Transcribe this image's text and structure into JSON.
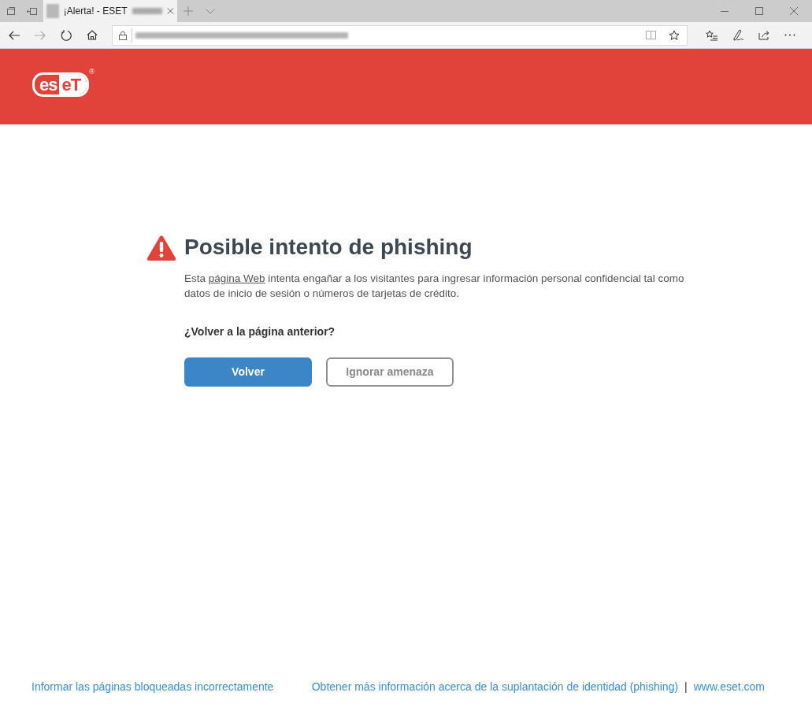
{
  "browser": {
    "tab": {
      "title": "¡Alerta! - ESET",
      "selected": true
    }
  },
  "header": {
    "logo_left": "es",
    "logo_right": "eT",
    "logo_mark": "®"
  },
  "warning": {
    "title": "Posible intento de phishing",
    "description": {
      "before": "Esta ",
      "link": "página Web",
      "after": " intenta engañar a los visitantes para ingresar información personal confidencial tal como datos de inicio de sesión o números de tarjetas de crédito."
    },
    "question": "¿Volver a la página anterior?",
    "buttons": [
      {
        "label": "Volver",
        "kind": "primary"
      },
      {
        "label": "Ignorar amenaza",
        "kind": "secondary"
      }
    ]
  },
  "footer": {
    "left_link": "Informar las páginas bloqueadas incorrectamente",
    "right_links": [
      "Obtener más información acerca de la suplantación de identidad (phishing)",
      "www.eset.com"
    ],
    "separator": "|"
  }
}
